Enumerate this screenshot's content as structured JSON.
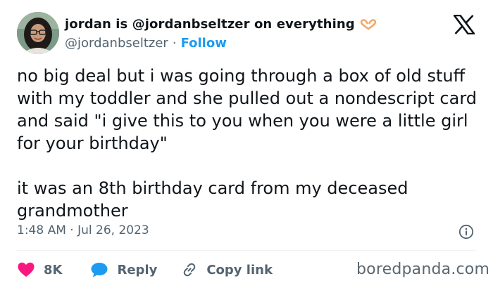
{
  "author": {
    "display_name": "jordan is @jordanbseltzer on everything",
    "handle": "@jordanbseltzer",
    "separator": "·",
    "follow_label": "Follow"
  },
  "icons": {
    "name_emoji": "heart-hands-icon",
    "platform_logo": "x-logo-icon",
    "info": "info-icon",
    "like": "heart-icon",
    "reply": "reply-bubble-icon",
    "copy_link": "link-icon"
  },
  "tweet": {
    "text": "no big deal but i was going through a box of old stuff with my toddler and she pulled out a nondescript card and said \"i give this to you when you were a little girl for your birthday\"\n\nit was an 8th birthday card from my deceased grandmother",
    "timestamp": "1:48 AM · Jul 26, 2023"
  },
  "actions": {
    "like_count": "8K",
    "reply_label": "Reply",
    "copy_link_label": "Copy link"
  },
  "watermark": "boredpanda.com",
  "colors": {
    "text_primary": "#0f1419",
    "text_secondary": "#536471",
    "accent": "#1d9bf0",
    "like": "#f91880",
    "heart_hands": "#f2a96a"
  }
}
